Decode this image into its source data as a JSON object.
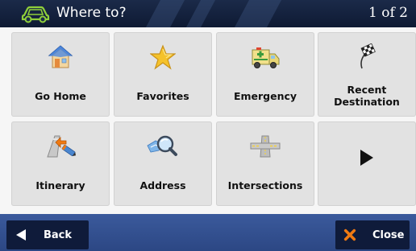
{
  "header": {
    "title": "Where to?",
    "page_indicator": "1 of 2",
    "icon": "car-icon"
  },
  "tiles": [
    {
      "label": "Go Home",
      "icon": "home-icon"
    },
    {
      "label": "Favorites",
      "icon": "star-icon"
    },
    {
      "label": "Emergency",
      "icon": "ambulance-icon"
    },
    {
      "label": "Recent\nDestination",
      "icon": "checkered-flag-icon"
    },
    {
      "label": "Itinerary",
      "icon": "route-icon"
    },
    {
      "label": "Address",
      "icon": "magnifier-icon"
    },
    {
      "label": "Intersections",
      "icon": "intersection-icon"
    },
    {
      "label": "",
      "icon": "next-arrow-icon"
    }
  ],
  "footer": {
    "back_label": "Back",
    "back_icon": "back-arrow-icon",
    "close_label": "Close",
    "close_icon": "close-x-icon"
  },
  "colors": {
    "header_bg": "#1b2a49",
    "footer_bg": "#34508f",
    "button_bg": "#0f1b3a",
    "tile_bg": "#e2e2e2",
    "accent_orange": "#f07a12",
    "home_roof": "#3a74c9",
    "star": "#f5c22b"
  }
}
